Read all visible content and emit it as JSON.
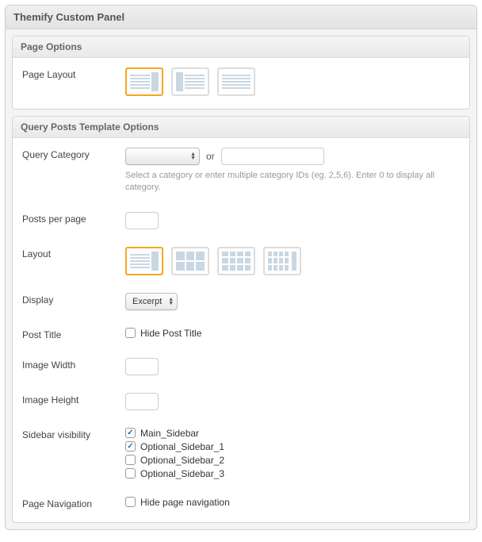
{
  "panel": {
    "title": "Themify Custom Panel"
  },
  "page_options": {
    "section_title": "Page Options",
    "page_layout_label": "Page Layout"
  },
  "query_posts": {
    "section_title": "Query Posts Template Options",
    "query_category_label": "Query Category",
    "or_text": "or",
    "category_hint": "Select a category or enter multiple category IDs (eg. 2,5,6). Enter 0 to display all category.",
    "posts_per_page_label": "Posts per page",
    "layout_label": "Layout",
    "display_label": "Display",
    "display_value": "Excerpt",
    "post_title_label": "Post Title",
    "hide_post_title_text": "Hide Post Title",
    "image_width_label": "Image Width",
    "image_height_label": "Image Height",
    "sidebar_visibility_label": "Sidebar visibility",
    "sidebars": {
      "main": "Main_Sidebar",
      "opt1": "Optional_Sidebar_1",
      "opt2": "Optional_Sidebar_2",
      "opt3": "Optional_Sidebar_3"
    },
    "page_navigation_label": "Page Navigation",
    "hide_page_navigation_text": "Hide page navigation"
  }
}
